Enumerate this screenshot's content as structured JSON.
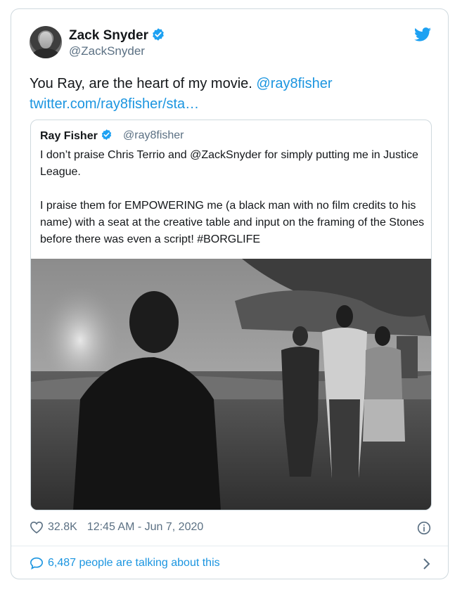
{
  "tweet": {
    "author_name": "Zack Snyder",
    "author_handle": "@ZackSnyder",
    "text": "You Ray, are the heart of my movie.",
    "mention": "@ray8fisher",
    "link": "twitter.com/ray8fisher/sta…",
    "likes": "32.8K",
    "timestamp": "12:45 AM - Jun 7, 2020",
    "talking": "6,487 people are talking about this"
  },
  "quote": {
    "author_name": "Ray Fisher",
    "author_handle": "@ray8fisher",
    "line1_pre": "I don’t praise Chris Terrio and ",
    "line1_mention": "@ZackSnyder",
    "line1_post": " for simply putting me in Justice League.",
    "paragraph2": "I praise them for EMPOWERING me (a black man with no film credits to his name) with a seat at the creative table and input on the framing of the Stones before there was even a script! #BORGLIFE"
  },
  "colors": {
    "link": "#1b95e0",
    "verified": "#1da1f2",
    "secondary_text": "#5b7083",
    "border": "#cfd9de"
  },
  "icons": [
    "verified-badge-icon",
    "twitter-bird-icon",
    "heart-icon",
    "info-icon",
    "speech-bubble-icon",
    "chevron-right-icon"
  ]
}
